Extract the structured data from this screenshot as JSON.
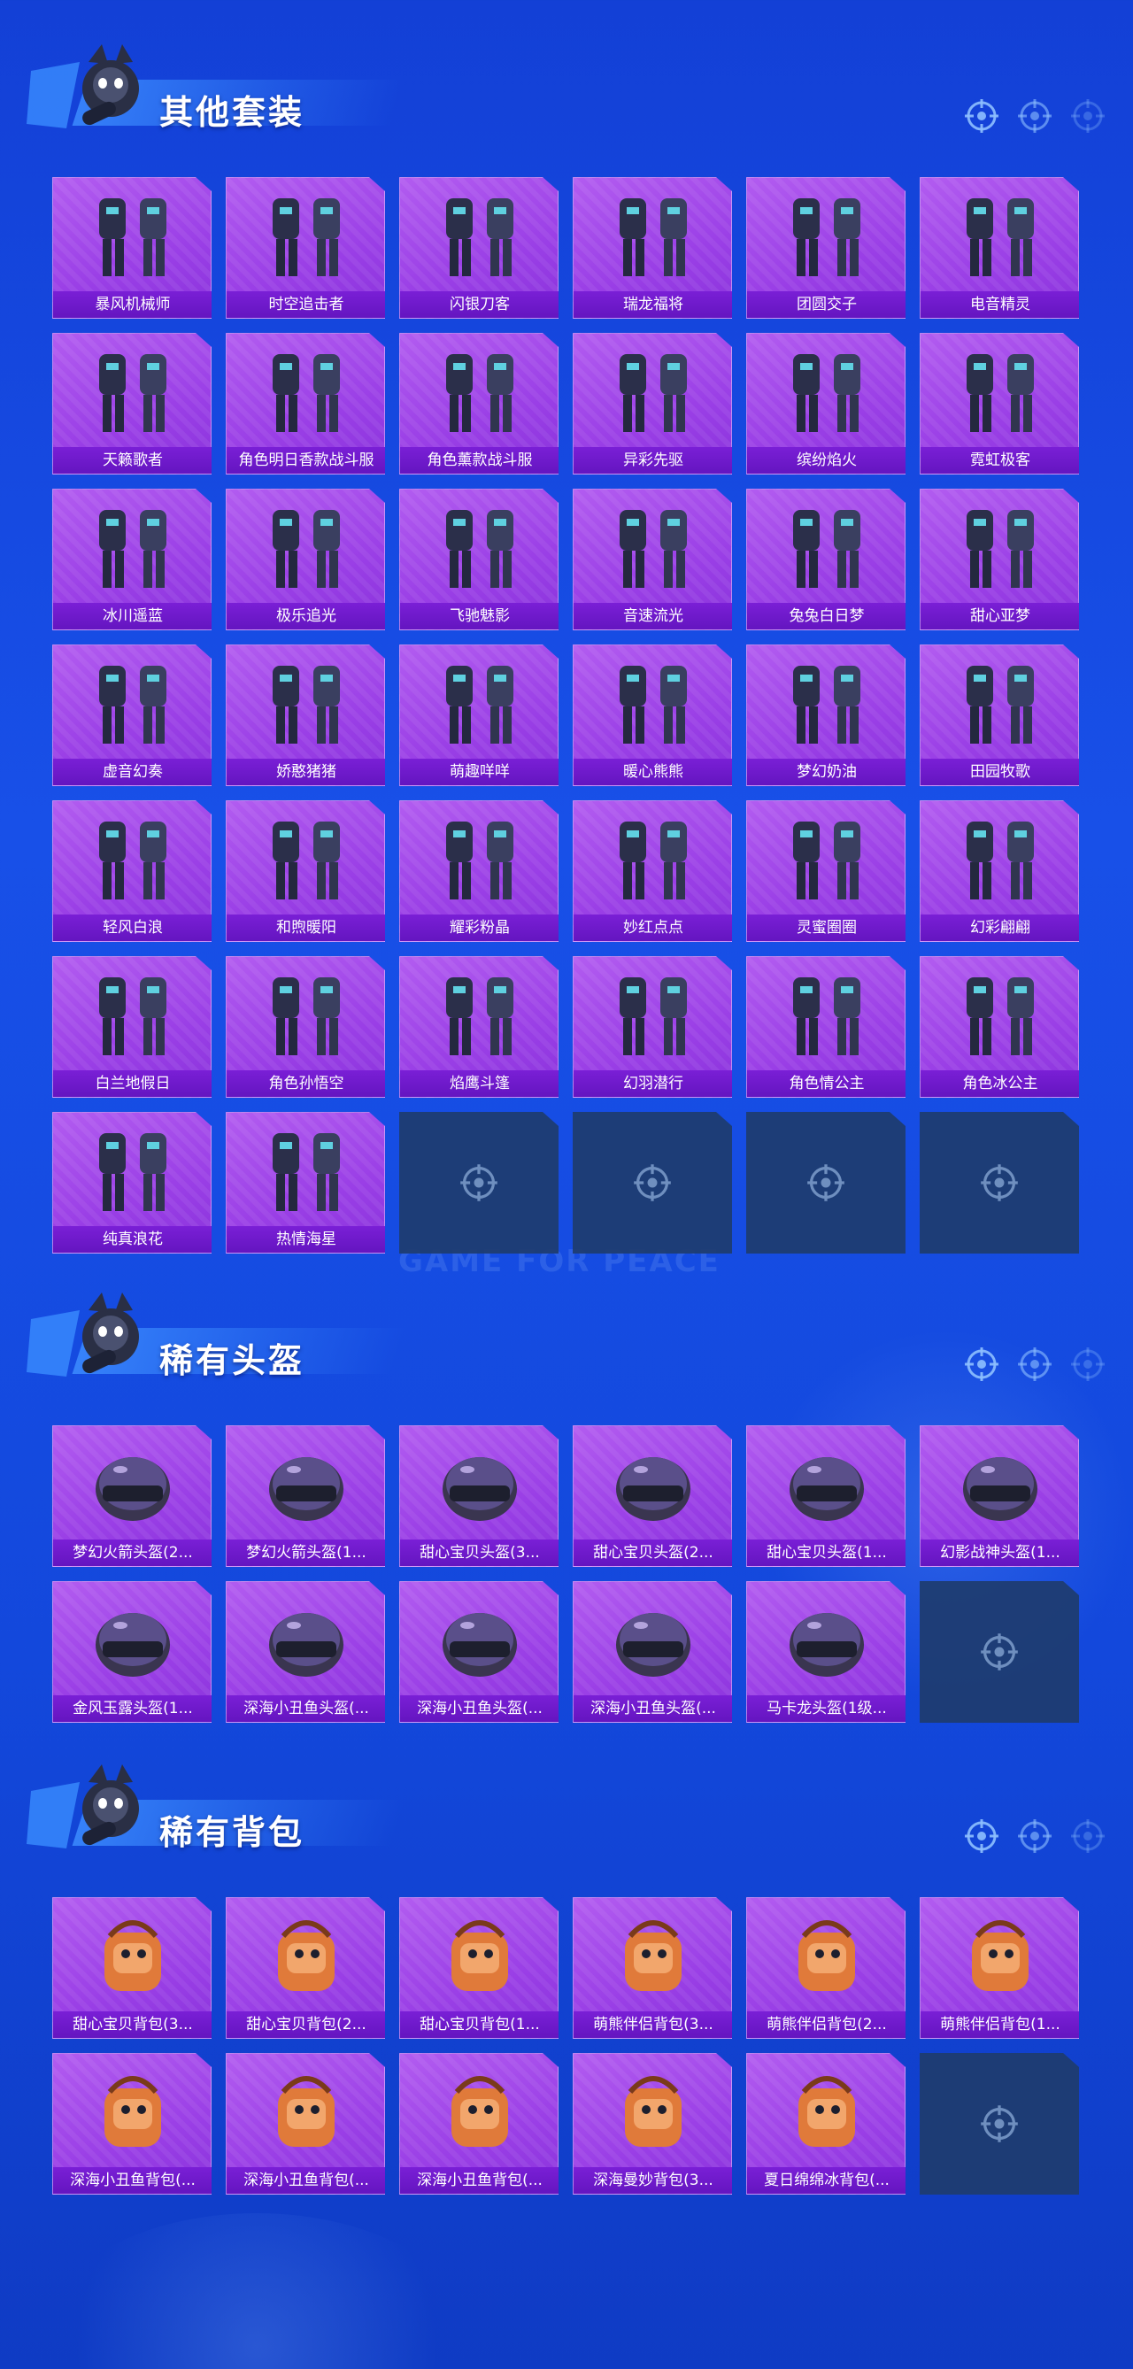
{
  "watermark": "GAME FOR PEACE",
  "colors": {
    "card": "#9a3fe6",
    "label_bar": "#6a18c6",
    "empty_slot": "#1e3c6e",
    "background": "#1548e0"
  },
  "sections": [
    {
      "title": "其他套装",
      "items": [
        "暴风机械师",
        "时空追击者",
        "闪银刀客",
        "瑞龙福将",
        "团圆交子",
        "电音精灵",
        "天籁歌者",
        "角色明日香款战斗服",
        "角色薰款战斗服",
        "异彩先驱",
        "缤纷焰火",
        "霓虹极客",
        "冰川遥蓝",
        "极乐追光",
        "飞驰魅影",
        "音速流光",
        "兔兔白日梦",
        "甜心亚梦",
        "虚音幻奏",
        "娇憨猪猪",
        "萌趣咩咩",
        "暖心熊熊",
        "梦幻奶油",
        "田园牧歌",
        "轻风白浪",
        "和煦暖阳",
        "耀彩粉晶",
        "妙红点点",
        "灵蜜圈圈",
        "幻彩翩翩",
        "白兰地假日",
        "角色孙悟空",
        "焰鹰斗篷",
        "幻羽潜行",
        "角色情公主",
        "角色冰公主",
        "纯真浪花",
        "热情海星"
      ],
      "empty_slots": 4
    },
    {
      "title": "稀有头盔",
      "items": [
        "梦幻火箭头盔(2...",
        "梦幻火箭头盔(1...",
        "甜心宝贝头盔(3...",
        "甜心宝贝头盔(2...",
        "甜心宝贝头盔(1...",
        "幻影战神头盔(1...",
        "金风玉露头盔(1...",
        "深海小丑鱼头盔(...",
        "深海小丑鱼头盔(...",
        "深海小丑鱼头盔(...",
        "马卡龙头盔(1级..."
      ],
      "empty_slots": 1
    },
    {
      "title": "稀有背包",
      "items": [
        "甜心宝贝背包(3...",
        "甜心宝贝背包(2...",
        "甜心宝贝背包(1...",
        "萌熊伴侣背包(3...",
        "萌熊伴侣背包(2...",
        "萌熊伴侣背包(1...",
        "深海小丑鱼背包(...",
        "深海小丑鱼背包(...",
        "深海小丑鱼背包(...",
        "深海曼妙背包(3...",
        "夏日绵绵冰背包(..."
      ],
      "empty_slots": 1
    }
  ]
}
